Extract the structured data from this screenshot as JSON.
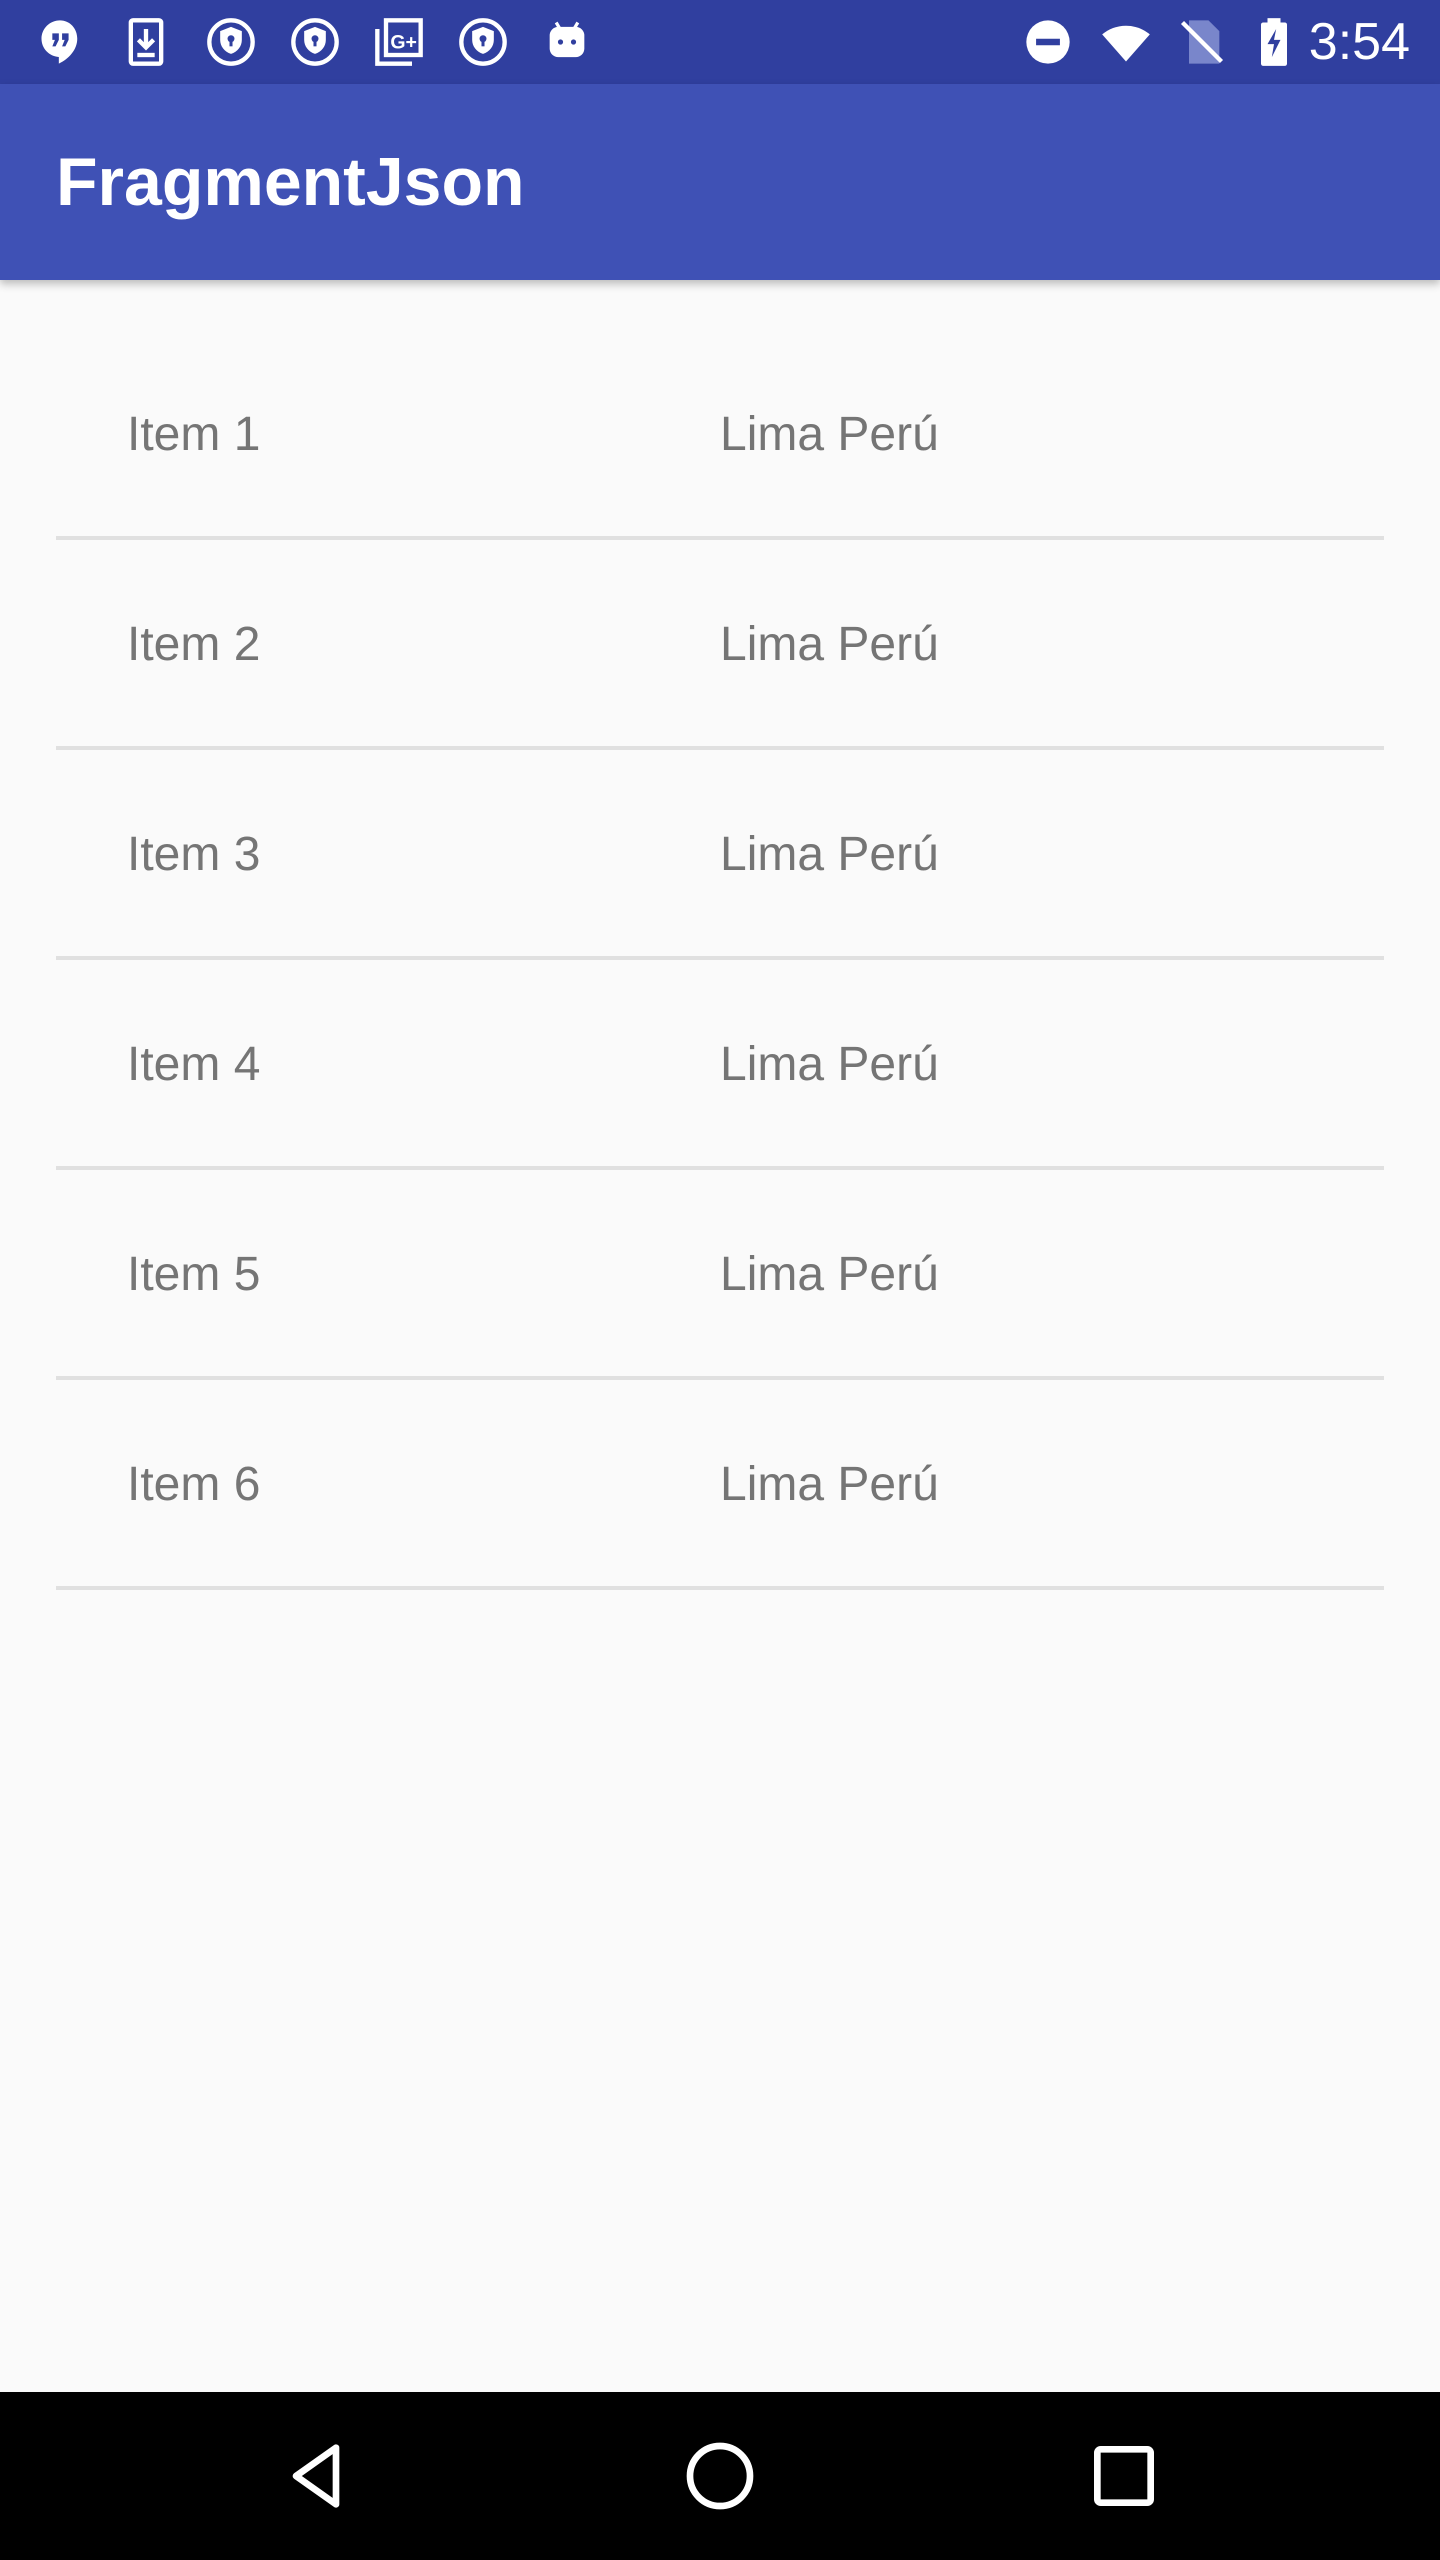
{
  "status_bar": {
    "left_icons": [
      "hangouts-icon",
      "download-icon",
      "vpn-key-icon",
      "vpn-key-icon",
      "google-plus-icon",
      "vpn-key-icon",
      "android-icon"
    ],
    "right_icons": [
      "do-not-disturb-icon",
      "wifi-icon",
      "no-sim-icon",
      "battery-charging-icon"
    ],
    "time": "3:54"
  },
  "app_bar": {
    "title": "FragmentJson"
  },
  "list": {
    "items": [
      {
        "name": "Item 1",
        "location": "Lima Perú"
      },
      {
        "name": "Item 2",
        "location": "Lima Perú"
      },
      {
        "name": "Item 3",
        "location": "Lima Perú"
      },
      {
        "name": "Item 4",
        "location": "Lima Perú"
      },
      {
        "name": "Item 5",
        "location": "Lima Perú"
      },
      {
        "name": "Item 6",
        "location": "Lima Perú"
      }
    ]
  },
  "nav_bar": {
    "buttons": [
      "back-icon",
      "home-icon",
      "recents-icon"
    ]
  },
  "colors": {
    "status_bar": "#303f9f",
    "app_bar": "#3f51b5",
    "background": "#fafafa",
    "text": "#757575",
    "divider": "#e0e0e0",
    "nav_bar": "#000000"
  }
}
